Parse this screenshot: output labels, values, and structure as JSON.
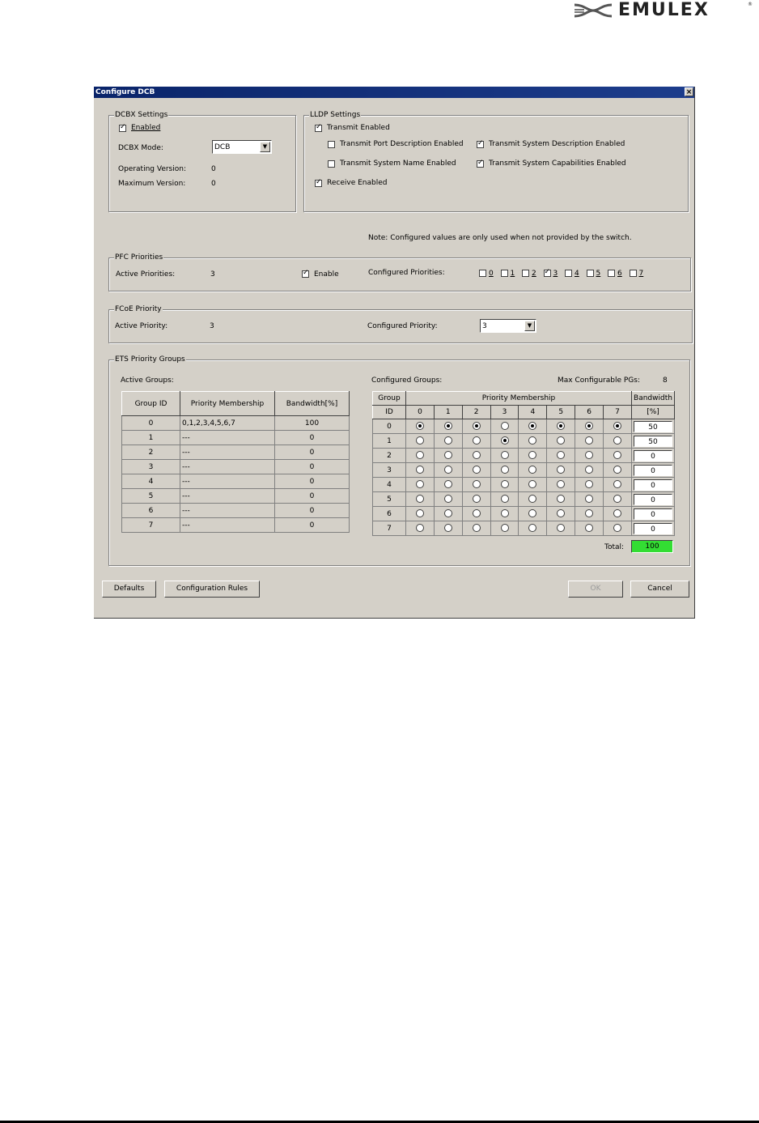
{
  "logo": {
    "text": "EMULEX",
    "registered": "®"
  },
  "dialog": {
    "title": "Configure DCB",
    "close": "×",
    "dcbx": {
      "legend": "DCBX Settings",
      "enabled_label": "Enabled",
      "enabled": true,
      "mode_label": "DCBX Mode:",
      "mode_value": "DCB",
      "operating_version_label": "Operating Version:",
      "operating_version": "0",
      "maximum_version_label": "Maximum Version:",
      "maximum_version": "0"
    },
    "lldp": {
      "legend": "LLDP Settings",
      "transmit_enabled": "Transmit Enabled",
      "transmit_port_desc": "Transmit Port Description Enabled",
      "transmit_sys_desc": "Transmit System Description Enabled",
      "transmit_sys_name": "Transmit System Name Enabled",
      "transmit_sys_caps": "Transmit System Capabilities Enabled",
      "receive_enabled": "Receive Enabled"
    },
    "note": "Note: Configured values are only used when not provided by the switch.",
    "pfc": {
      "legend": "PFC Priorities",
      "active_label": "Active Priorities:",
      "active_value": "3",
      "enable_label": "Enable",
      "configured_label": "Configured Priorities:",
      "priorities": [
        "0",
        "1",
        "2",
        "3",
        "4",
        "5",
        "6",
        "7"
      ],
      "checked": [
        false,
        false,
        false,
        true,
        false,
        false,
        false,
        false
      ]
    },
    "fcoe": {
      "legend": "FCoE Priority",
      "active_label": "Active Priority:",
      "active_value": "3",
      "configured_label": "Configured Priority:",
      "configured_value": "3"
    },
    "ets": {
      "legend": "ETS Priority Groups",
      "active_groups_label": "Active Groups:",
      "active_headers": {
        "group": "Group ID",
        "membership": "Priority Membership",
        "bandwidth": "Bandwidth[%]"
      },
      "active_rows": [
        {
          "id": "0",
          "membership": "0,1,2,3,4,5,6,7",
          "bandwidth": "100"
        },
        {
          "id": "1",
          "membership": "---",
          "bandwidth": "0"
        },
        {
          "id": "2",
          "membership": "---",
          "bandwidth": "0"
        },
        {
          "id": "3",
          "membership": "---",
          "bandwidth": "0"
        },
        {
          "id": "4",
          "membership": "---",
          "bandwidth": "0"
        },
        {
          "id": "5",
          "membership": "---",
          "bandwidth": "0"
        },
        {
          "id": "6",
          "membership": "---",
          "bandwidth": "0"
        },
        {
          "id": "7",
          "membership": "---",
          "bandwidth": "0"
        }
      ],
      "configured_groups_label": "Configured Groups:",
      "max_pgs_label": "Max Configurable PGs:",
      "max_pgs_value": "8",
      "config_headers": {
        "group": "Group",
        "id": "ID",
        "membership": "Priority Membership",
        "bandwidth": "Bandwidth",
        "pct": "[%]"
      },
      "priority_columns": [
        "0",
        "1",
        "2",
        "3",
        "4",
        "5",
        "6",
        "7"
      ],
      "config_rows": [
        {
          "id": "0",
          "selected": [
            0,
            1,
            2,
            4,
            5,
            6,
            7
          ],
          "bandwidth": "50"
        },
        {
          "id": "1",
          "selected": [
            3
          ],
          "bandwidth": "50"
        },
        {
          "id": "2",
          "selected": [],
          "bandwidth": "0"
        },
        {
          "id": "3",
          "selected": [],
          "bandwidth": "0"
        },
        {
          "id": "4",
          "selected": [],
          "bandwidth": "0"
        },
        {
          "id": "5",
          "selected": [],
          "bandwidth": "0"
        },
        {
          "id": "6",
          "selected": [],
          "bandwidth": "0"
        },
        {
          "id": "7",
          "selected": [],
          "bandwidth": "0"
        }
      ],
      "total_label": "Total:",
      "total_value": "100",
      "total_color": "#33dd33"
    },
    "buttons": {
      "defaults": "Defaults",
      "rules": "Configuration Rules",
      "ok": "OK",
      "cancel": "Cancel"
    }
  }
}
